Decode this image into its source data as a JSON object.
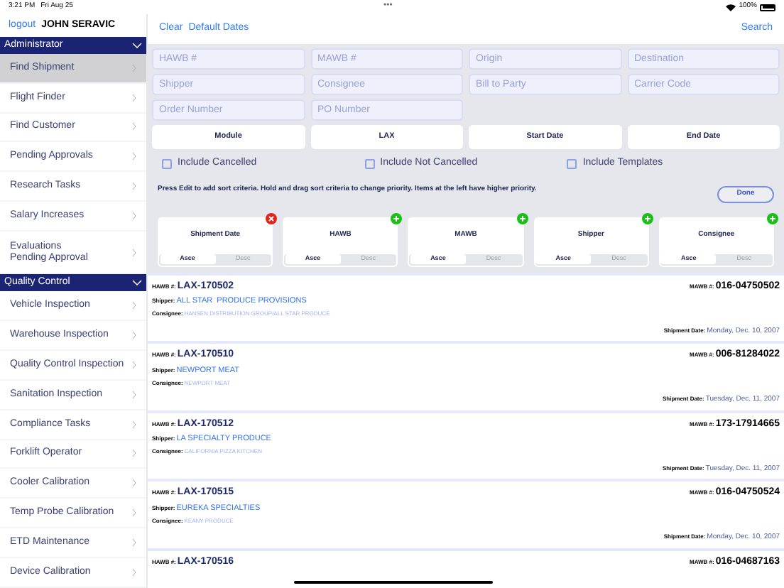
{
  "status_bar": {
    "time": "3:21 PM",
    "date": "Fri Aug 25",
    "dots": "•••",
    "battery": "100%"
  },
  "header": {
    "logout": "logout",
    "user": "JOHN SERAVIC",
    "clear": "Clear",
    "default_dates": "Default Dates",
    "search": "Search"
  },
  "sidebar": {
    "sections": [
      {
        "title": "Administrator",
        "expanded": true,
        "items": [
          {
            "label": "Find Shipment",
            "selected": true
          },
          {
            "label": "Flight Finder",
            "selected": false
          },
          {
            "label": "Find Customer",
            "selected": false
          },
          {
            "label": "Pending Approvals",
            "selected": false
          },
          {
            "label": "Research Tasks",
            "selected": false
          },
          {
            "label": "Salary Increases",
            "selected": false
          },
          {
            "label": "Evaluations\nPending Approval",
            "selected": false
          }
        ]
      },
      {
        "title": "Quality Control",
        "expanded": true,
        "items": [
          {
            "label": "Vehicle Inspection",
            "selected": false
          },
          {
            "label": "Warehouse Inspection",
            "selected": false
          },
          {
            "label": "Quality Control Inspection",
            "selected": false
          },
          {
            "label": "Sanitation Inspection",
            "selected": false
          },
          {
            "label": "Compliance Tasks",
            "selected": false
          },
          {
            "label": "Forklift Operator",
            "selected": false
          },
          {
            "label": "Cooler Calibration",
            "selected": false
          },
          {
            "label": "Temp Probe Calibration",
            "selected": false
          },
          {
            "label": "ETD Maintenance",
            "selected": false
          },
          {
            "label": "Device Calibration",
            "selected": false
          }
        ]
      }
    ]
  },
  "fields": [
    {
      "placeholder": "HAWB #"
    },
    {
      "placeholder": "MAWB #"
    },
    {
      "placeholder": "Origin"
    },
    {
      "placeholder": "Destination"
    },
    {
      "placeholder": "Shipper"
    },
    {
      "placeholder": "Consignee"
    },
    {
      "placeholder": "Bill to Party"
    },
    {
      "placeholder": "Carrier Code"
    },
    {
      "placeholder": "Order Number"
    },
    {
      "placeholder": "PO Number"
    }
  ],
  "pickers": [
    "Module",
    "LAX",
    "Start Date",
    "End Date"
  ],
  "checkboxes": [
    {
      "label": "Include Cancelled",
      "checked": false
    },
    {
      "label": "Include Not Cancelled",
      "checked": false
    },
    {
      "label": "Include Templates",
      "checked": false
    }
  ],
  "help_text": "Press Edit to add sort criteria. Hold and drag sort criteria to change priority. Items at the left have higher priority.",
  "done_button": "Done",
  "sort_criteria": [
    {
      "title": "Shipment Date",
      "kind": "remove",
      "options": [
        {
          "label": "Asce",
          "selected": true
        },
        {
          "label": "Desc",
          "selected": false
        }
      ]
    },
    {
      "title": "HAWB",
      "kind": "add",
      "options": [
        {
          "label": "Asce",
          "selected": true
        },
        {
          "label": "Desc",
          "selected": false
        }
      ]
    },
    {
      "title": "MAWB",
      "kind": "add",
      "options": [
        {
          "label": "Asce",
          "selected": true
        },
        {
          "label": "Desc",
          "selected": false
        }
      ]
    },
    {
      "title": "Shipper",
      "kind": "add",
      "options": [
        {
          "label": "Asce",
          "selected": true
        },
        {
          "label": "Desc",
          "selected": false
        }
      ]
    },
    {
      "title": "Consignee",
      "kind": "add",
      "options": [
        {
          "label": "Asce",
          "selected": true
        },
        {
          "label": "Desc",
          "selected": false
        }
      ]
    }
  ],
  "results": [
    {
      "hawb_label": "HAWB #:",
      "hawb": "LAX-170502",
      "mawb_label": "MAWB #:",
      "mawb": "016-04750502",
      "shipper_label": "Shipper:",
      "shipper": "ALL STAR  PRODUCE PROVISIONS",
      "consignee_label": "Consignee:",
      "consignee": "HANSEN DISTRIBUTION GROUP/ALL STAR PRODUCE",
      "date_label": "Shipment Date:",
      "date": "Monday, Dec. 10, 2007"
    },
    {
      "hawb_label": "HAWB #:",
      "hawb": "LAX-170510",
      "mawb_label": "MAWB #:",
      "mawb": "006-81284022",
      "shipper_label": "Shipper:",
      "shipper": "NEWPORT MEAT",
      "consignee_label": "Consignee:",
      "consignee": "NEWPORT MEAT",
      "date_label": "Shipment Date:",
      "date": "Tuesday, Dec. 11, 2007"
    },
    {
      "hawb_label": "HAWB #:",
      "hawb": "LAX-170512",
      "mawb_label": "MAWB #:",
      "mawb": "173-17914665",
      "shipper_label": "Shipper:",
      "shipper": "LA SPECIALTY PRODUCE",
      "consignee_label": "Consignee:",
      "consignee": "CALIFORNIA PIZZA KITCHEN",
      "date_label": "Shipment Date:",
      "date": "Tuesday, Dec. 11, 2007"
    },
    {
      "hawb_label": "HAWB #:",
      "hawb": "LAX-170515",
      "mawb_label": "MAWB #:",
      "mawb": "016-04750524",
      "shipper_label": "Shipper:",
      "shipper": "EUREKA SPECIALTIES",
      "consignee_label": "Consignee:",
      "consignee": "KEANY PRODUCE",
      "date_label": "Shipment Date:",
      "date": "Monday, Dec. 10, 2007"
    },
    {
      "hawb_label": "HAWB #:",
      "hawb": "LAX-170516",
      "mawb_label": "MAWB #:",
      "mawb": "016-04687163"
    }
  ]
}
